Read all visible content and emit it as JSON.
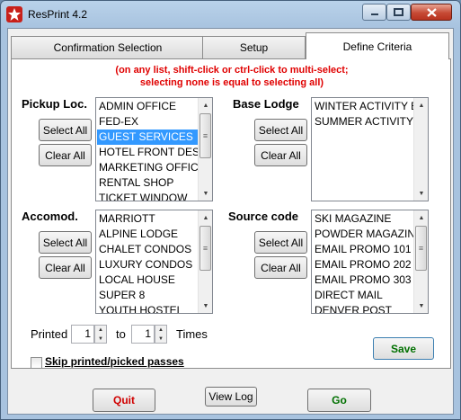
{
  "window": {
    "title": "ResPrint 4.2",
    "icon": "app-star-icon",
    "controls": {
      "minimize": "minimize-icon",
      "maximize": "maximize-icon",
      "close": "close-icon"
    }
  },
  "tabs": [
    {
      "label": "Confirmation Selection",
      "active": false
    },
    {
      "label": "Setup",
      "active": false
    },
    {
      "label": "Define Criteria",
      "active": true
    }
  ],
  "criteria": {
    "note_line1": "(on any list, shift-click or ctrl-click to multi-select;",
    "note_line2": "selecting none is equal to selecting all)",
    "select_all_label": "Select All",
    "clear_all_label": "Clear All",
    "pickup": {
      "label": "Pickup Loc.",
      "items": [
        "ADMIN OFFICE",
        "FED-EX",
        "GUEST SERVICES",
        "HOTEL FRONT DES",
        "MARKETING OFFICI",
        "RENTAL SHOP",
        "TICKET WINDOW"
      ],
      "selected": "GUEST SERVICES"
    },
    "base_lodge": {
      "label": "Base Lodge",
      "items": [
        "WINTER ACTIVITY E",
        "SUMMER ACTIVITY"
      ]
    },
    "accomod": {
      "label": "Accomod.",
      "items": [
        "MARRIOTT",
        "ALPINE LODGE",
        "CHALET CONDOS",
        "LUXURY CONDOS",
        "LOCAL HOUSE",
        "SUPER 8",
        "YOUTH HOSTEL"
      ]
    },
    "source_code": {
      "label": "Source code",
      "items": [
        "SKI MAGAZINE",
        "POWDER MAGAZIN",
        "EMAIL PROMO 101",
        "EMAIL PROMO 202",
        "EMAIL PROMO 303",
        "DIRECT MAIL",
        "DENVER POST"
      ]
    },
    "printed_label": "Printed",
    "printed_from": "1",
    "to_label": "to",
    "printed_to": "1",
    "times_label": "Times",
    "save_label": "Save"
  },
  "skip_printed_label": "Skip printed/picked passes",
  "skip_printed_checked": false,
  "footer": {
    "quit_label": "Quit",
    "view_log_label": "View Log",
    "go_label": "Go"
  },
  "colors": {
    "note_red": "#e00000",
    "quit_red": "#d00000",
    "go_green": "#007000",
    "save_green": "#007000",
    "selection_blue": "#3399ff"
  }
}
